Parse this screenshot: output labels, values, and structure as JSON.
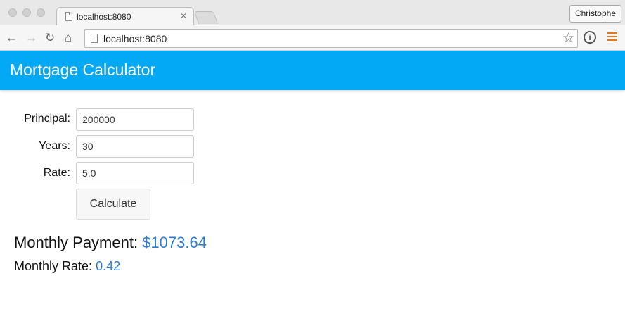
{
  "browser": {
    "tab_title": "localhost:8080",
    "tab_close": "×",
    "profile_name": "Christophe",
    "url": "localhost:8080",
    "icons": {
      "back": "back-arrow-icon",
      "forward": "forward-arrow-icon",
      "reload": "reload-icon",
      "home": "home-icon",
      "bookmark": "star-icon",
      "info": "info-icon",
      "menu": "hamburger-menu-icon"
    }
  },
  "app": {
    "title": "Mortgage Calculator",
    "accent_color": "#03a9f4",
    "value_color": "#2b7bd6",
    "form": {
      "principal_label": "Principal:",
      "principal_value": "200000",
      "years_label": "Years:",
      "years_value": "30",
      "rate_label": "Rate:",
      "rate_value": "5.0",
      "calculate_label": "Calculate"
    },
    "results": {
      "payment_label": "Monthly Payment:",
      "payment_value": "$1073.64",
      "rate_label": "Monthly Rate:",
      "rate_value": "0.42"
    }
  }
}
